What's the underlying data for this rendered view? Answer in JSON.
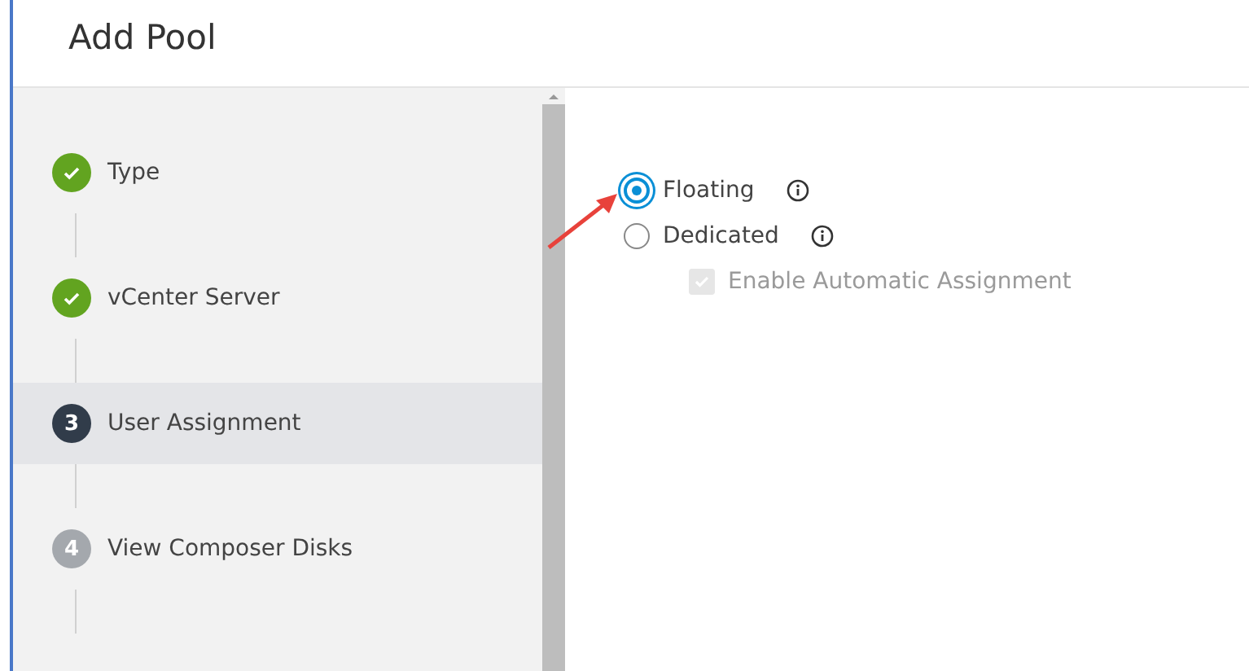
{
  "title": "Add Pool",
  "steps": [
    {
      "label": "Type",
      "kind": "done",
      "selected": false
    },
    {
      "label": "vCenter Server",
      "kind": "done",
      "selected": false
    },
    {
      "label": "User Assignment",
      "kind": "current",
      "number": "3",
      "selected": true
    },
    {
      "label": "View Composer Disks",
      "kind": "pending",
      "number": "4",
      "selected": false
    }
  ],
  "options": [
    {
      "label": "Floating",
      "selected": true
    },
    {
      "label": "Dedicated",
      "selected": false
    }
  ],
  "auto_assign": {
    "label": "Enable Automatic Assignment",
    "checked": true,
    "disabled": true
  }
}
